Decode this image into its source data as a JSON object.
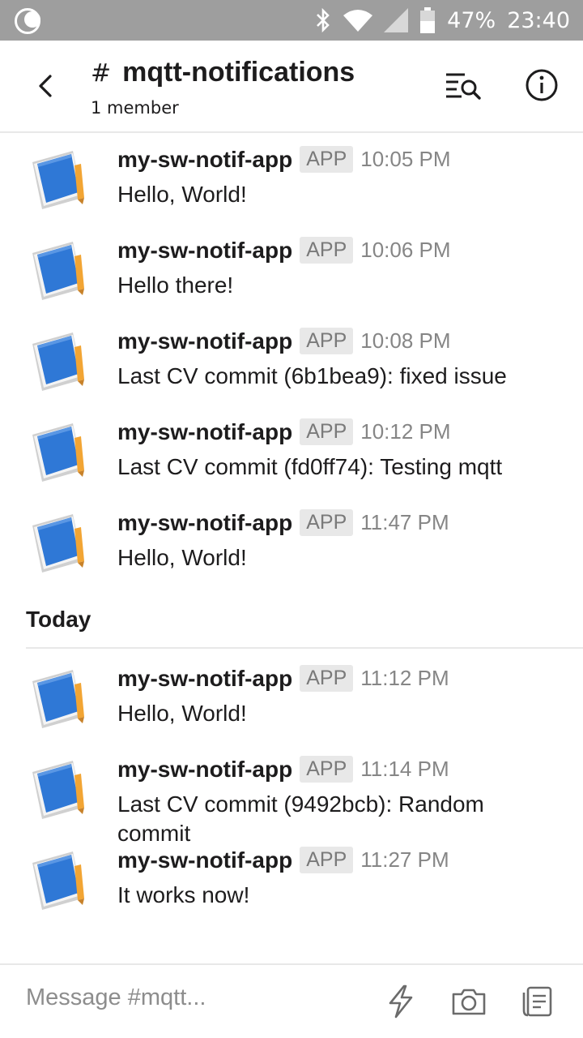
{
  "status_bar": {
    "battery": "47%",
    "time": "23:40",
    "icons": [
      "moon-icon",
      "bluetooth-icon",
      "wifi-icon",
      "signal-icon",
      "battery-icon"
    ]
  },
  "header": {
    "hash": "#",
    "channel_name": "mqtt-notifications",
    "member_count": "1 member",
    "icons": [
      "back-arrow-icon",
      "search-messages-icon",
      "info-icon"
    ]
  },
  "messages_before": [
    {
      "sender": "my-sw-notif-app",
      "badge": "APP",
      "time": "10:05 PM",
      "text": "Hello, World!"
    },
    {
      "sender": "my-sw-notif-app",
      "badge": "APP",
      "time": "10:06 PM",
      "text": "Hello there!"
    },
    {
      "sender": "my-sw-notif-app",
      "badge": "APP",
      "time": "10:08 PM",
      "text": "Last CV commit (6b1bea9): fixed issue"
    },
    {
      "sender": "my-sw-notif-app",
      "badge": "APP",
      "time": "10:12 PM",
      "text": "Last CV commit (fd0ff74): Testing mqtt"
    },
    {
      "sender": "my-sw-notif-app",
      "badge": "APP",
      "time": "11:47 PM",
      "text": "Hello, World!"
    }
  ],
  "day_divider": "Today",
  "messages_today": [
    {
      "sender": "my-sw-notif-app",
      "badge": "APP",
      "time": "11:12 PM",
      "text": "Hello, World!"
    },
    {
      "sender": "my-sw-notif-app",
      "badge": "APP",
      "time": "11:14 PM",
      "text": "Last CV commit (9492bcb): Random commit"
    },
    {
      "sender": "my-sw-notif-app",
      "badge": "APP",
      "time": "11:27 PM",
      "text": "It works now!"
    }
  ],
  "composer": {
    "placeholder": "Message #mqtt...",
    "icons": [
      "lightning-icon",
      "camera-icon",
      "attachment-icon"
    ]
  },
  "colors": {
    "status_bar_bg": "#9e9e9e",
    "avatar_blue": "#2f78d6",
    "avatar_orange": "#f2a534",
    "badge_bg": "#e8e8e8"
  }
}
